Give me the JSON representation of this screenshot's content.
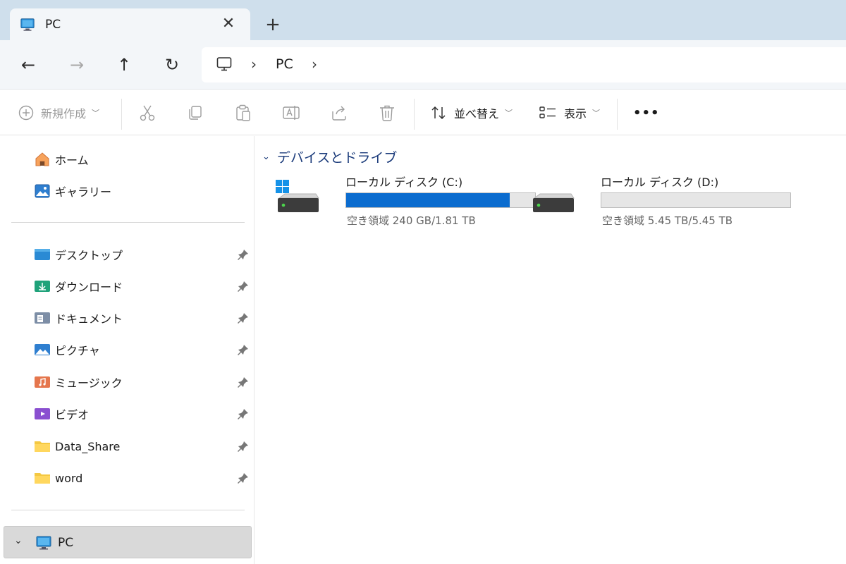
{
  "window": {
    "tab_title": "PC",
    "tab_close": "✕",
    "new_tab": "+"
  },
  "nav": {
    "back": "←",
    "forward": "→",
    "up": "↑",
    "refresh": "↻"
  },
  "breadcrumb": {
    "sep": "›",
    "items": [
      "PC"
    ]
  },
  "toolbar": {
    "new_label": "新規作成",
    "sort_label": "並べ替え",
    "view_label": "表示",
    "more_label": "•••"
  },
  "sidebar": {
    "top_items": [
      {
        "label": "ホーム",
        "icon": "home-icon"
      },
      {
        "label": "ギャラリー",
        "icon": "gallery-icon"
      }
    ],
    "pinned_items": [
      {
        "label": "デスクトップ",
        "icon": "desktop-folder-icon"
      },
      {
        "label": "ダウンロード",
        "icon": "downloads-folder-icon"
      },
      {
        "label": "ドキュメント",
        "icon": "documents-folder-icon"
      },
      {
        "label": "ピクチャ",
        "icon": "pictures-folder-icon"
      },
      {
        "label": "ミュージック",
        "icon": "music-folder-icon"
      },
      {
        "label": "ビデオ",
        "icon": "videos-folder-icon"
      },
      {
        "label": "Data_Share",
        "icon": "folder-icon"
      },
      {
        "label": "word",
        "icon": "folder-icon"
      }
    ],
    "pc_label": "PC",
    "pc_chevron": "⌄"
  },
  "content": {
    "group_title": "デバイスとドライブ",
    "group_chevron": "⌄",
    "drives": [
      {
        "name": "ローカル ディスク (C:)",
        "free": "空き領域 240 GB/1.81 TB",
        "used_fraction": 0.867,
        "system": true
      },
      {
        "name": "ローカル ディスク (D:)",
        "free": "空き領域 5.45 TB/5.45 TB",
        "used_fraction": 0.0,
        "system": false
      }
    ]
  },
  "colors": {
    "accent": "#0b6ccf",
    "titlebar": "#cfdfec",
    "group_header": "#1a3a7a"
  }
}
